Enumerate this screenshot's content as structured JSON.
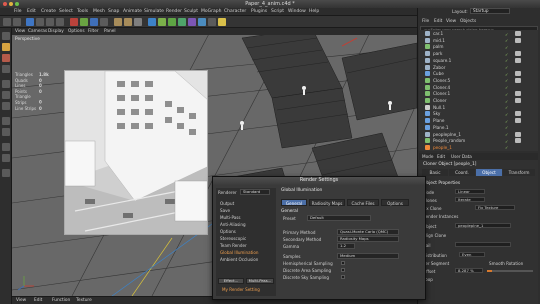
{
  "window": {
    "title": "Paper_4_anim.c4d *"
  },
  "menubar": {
    "items": [
      "File",
      "Edit",
      "Create",
      "Select",
      "Tools",
      "Mesh",
      "Snap",
      "Animate",
      "Simulate",
      "Render",
      "Sculpt",
      "MoGraph",
      "Character",
      "Plugins",
      "Script",
      "Window",
      "Help"
    ],
    "layout_label": "Layout:",
    "layout_value": "Startup"
  },
  "viewport": {
    "menu": [
      "View",
      "Cameras",
      "Display",
      "Options",
      "Filter",
      "Panel"
    ],
    "camera_label": "Perspective",
    "stats": [
      {
        "k": "Triangles",
        "v": "1.8k"
      },
      {
        "k": "Quads",
        "v": "0"
      },
      {
        "k": "Lines",
        "v": "0"
      },
      {
        "k": "Points",
        "v": "0"
      },
      {
        "k": "Triangle Strips",
        "v": "0"
      },
      {
        "k": "Line Strips",
        "v": "0"
      }
    ]
  },
  "timeline": {
    "items": [
      "View",
      "Edit",
      "Function",
      "Texture"
    ]
  },
  "objects_panel": {
    "menu": [
      "File",
      "Edit",
      "View",
      "Objects"
    ],
    "search_placeholder": "<<Enter your search string here>>",
    "rows": [
      {
        "name": "car.1",
        "color": "#9fb3c8",
        "hl": false
      },
      {
        "name": "mid.1",
        "color": "#9fb3c8",
        "hl": false
      },
      {
        "name": "palm",
        "color": "#7fbf6f",
        "hl": false
      },
      {
        "name": "park",
        "color": "#9fb3c8",
        "hl": false
      },
      {
        "name": "square.1",
        "color": "#9fb3c8",
        "hl": false
      },
      {
        "name": "Zabor",
        "color": "#9fb3c8",
        "hl": false
      },
      {
        "name": "Cube",
        "color": "#6aa0e0",
        "hl": false
      },
      {
        "name": "Cloner.5",
        "color": "#7fbf6f",
        "hl": false
      },
      {
        "name": "Cloner.4",
        "color": "#7fbf6f",
        "hl": false
      },
      {
        "name": "Cloner.1",
        "color": "#7fbf6f",
        "hl": false
      },
      {
        "name": "Cloner",
        "color": "#7fbf6f",
        "hl": false
      },
      {
        "name": "Null.1",
        "color": "#cfcfcf",
        "hl": false
      },
      {
        "name": "Sky",
        "color": "#6aa0e0",
        "hl": false
      },
      {
        "name": "Plane",
        "color": "#6aa0e0",
        "hl": false
      },
      {
        "name": "Plane.1",
        "color": "#6aa0e0",
        "hl": false
      },
      {
        "name": "peopleplne_1",
        "color": "#9fb3c8",
        "hl": false
      },
      {
        "name": "People_random",
        "color": "#7fbf6f",
        "hl": false
      },
      {
        "name": "people_1",
        "color": "#f08a3a",
        "hl": true
      }
    ]
  },
  "attributes": {
    "menu": [
      "Mode",
      "Edit",
      "User Data"
    ],
    "tabs": [
      "Basic",
      "Coord.",
      "Object",
      "Transform"
    ],
    "header": "Cloner Object [people_1]",
    "section": "Object Properties",
    "rows": [
      {
        "label": "Mode",
        "value": "Linear"
      },
      {
        "label": "Clones",
        "value": "Iterate"
      },
      {
        "label": "Fix Clone",
        "value": "Fix Texture"
      },
      {
        "label": "Render Instances",
        "value": ""
      },
      {
        "label": "Object",
        "value": "peopleplne_1"
      },
      {
        "label": "Align Clone",
        "value": ""
      },
      {
        "label": "Rail",
        "value": ""
      },
      {
        "label": "Distribution",
        "value": "Even"
      },
      {
        "label": "Per Segment",
        "value": "Smooth Rotation"
      },
      {
        "label": "Offset",
        "value": "8.287 %"
      },
      {
        "label": "Loop",
        "value": ""
      }
    ]
  },
  "render_settings": {
    "title": "Render Settings",
    "renderer_label": "Renderer",
    "renderer_value": "Standard",
    "sidebar": [
      "Output",
      "Save",
      "Multi-Pass",
      "Anti-Aliasing",
      "Options",
      "Stereoscopic",
      "Team Render",
      "Global Illumination",
      "Ambient Occlusion"
    ],
    "sidebar_selected": "Global Illumination",
    "effect_button": "Effect...",
    "multipass_button": "Multi-Pass...",
    "preset_label": "My Render Setting",
    "section_title": "Global Illumination",
    "tabs": [
      "General",
      "Radiosity Maps",
      "Cache Files",
      "Options"
    ],
    "active_tab": "General",
    "group_label": "General",
    "rows": [
      {
        "label": "Preset",
        "value": "Default"
      },
      {
        "label": "Primary Method",
        "value": "Quasi-Monte Carlo (QMC)"
      },
      {
        "label": "Secondary Method",
        "value": "Radiosity Maps"
      },
      {
        "label": "Gamma",
        "value": "1.2"
      },
      {
        "label": "Samples",
        "value": "Medium"
      },
      {
        "label": "Hemispherical Sampling",
        "value": ""
      },
      {
        "label": "Discrete Area Sampling",
        "value": ""
      },
      {
        "label": "Discrete Sky Sampling",
        "value": ""
      }
    ]
  }
}
